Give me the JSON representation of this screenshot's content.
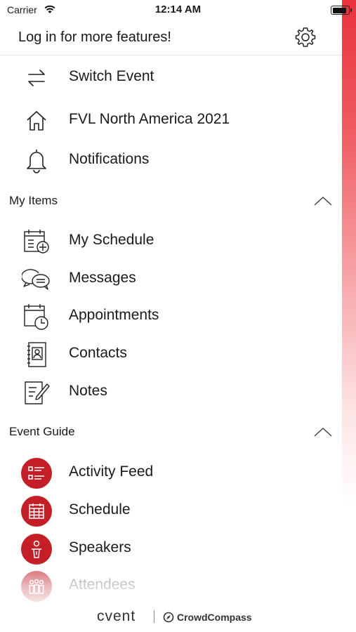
{
  "status_bar": {
    "carrier": "Carrier",
    "time": "12:14 AM"
  },
  "header": {
    "login_text": "Log in for more features!"
  },
  "top_items": [
    {
      "label": "Switch Event",
      "icon": "switch-arrows-icon"
    },
    {
      "label": "FVL North America 2021",
      "icon": "home-icon"
    },
    {
      "label": "Notifications",
      "icon": "bell-icon"
    }
  ],
  "my_items": {
    "title": "My Items",
    "items": [
      {
        "label": "My Schedule",
        "icon": "calendar-add-icon"
      },
      {
        "label": "Messages",
        "icon": "chat-bubbles-icon"
      },
      {
        "label": "Appointments",
        "icon": "calendar-clock-icon"
      },
      {
        "label": "Contacts",
        "icon": "contacts-book-icon"
      },
      {
        "label": "Notes",
        "icon": "notes-pencil-icon"
      }
    ]
  },
  "event_guide": {
    "title": "Event Guide",
    "items": [
      {
        "label": "Activity Feed",
        "icon": "activity-list-icon"
      },
      {
        "label": "Schedule",
        "icon": "schedule-grid-icon"
      },
      {
        "label": "Speakers",
        "icon": "speaker-podium-icon"
      },
      {
        "label": "Attendees",
        "icon": "attendees-group-icon"
      }
    ]
  },
  "footer": {
    "brand": "cvent",
    "partner": "CrowdCompass"
  },
  "colors": {
    "accent": "#c41e26",
    "text": "#1a1a1a"
  }
}
